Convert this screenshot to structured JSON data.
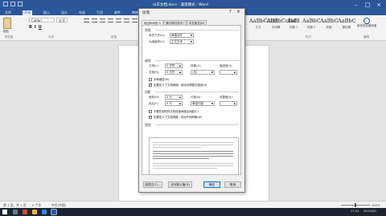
{
  "window": {
    "title": "山羊文档.docx - 兼容模式 - Word"
  },
  "ribbon_tabs": [
    "文件",
    "开始",
    "插入",
    "设计",
    "布局",
    "引用",
    "邮件",
    "审阅",
    "视图",
    "百度网盘"
  ],
  "ribbon": {
    "paste_label": "粘贴",
    "font_name": "Calibri",
    "font_size": "五号",
    "format_buttons": [
      "B",
      "I",
      "U"
    ],
    "groups": [
      "剪贴板",
      "字体",
      "段落",
      "样式",
      "编辑"
    ],
    "styles": [
      {
        "preview": "AaBbCcDd",
        "name": "正文"
      },
      {
        "preview": "AaBbCcDd",
        "name": "无间隔"
      },
      {
        "preview": "AaBl",
        "name": "标题 1"
      },
      {
        "preview": "AaBbC",
        "name": "标题 2"
      },
      {
        "preview": "AaBbC",
        "name": "标题"
      },
      {
        "preview": "AaBbC",
        "name": "副标题"
      }
    ],
    "right_tool_label": "保存到百度网盘"
  },
  "dialog": {
    "title": "段落",
    "help": "?",
    "close": "×",
    "tabs": [
      "缩进和间距(I)",
      "换行和分页(P)",
      "中文版式(H)"
    ],
    "general": {
      "heading": "常规",
      "alignment_label": "对齐方式(G):",
      "alignment_value": "两端对齐",
      "outline_label": "大纲级别(O):",
      "outline_value": "正文文本"
    },
    "indent": {
      "heading": "缩进",
      "left_label": "左侧(L):",
      "left_value": "0 字符",
      "right_label": "右侧(R):",
      "right_value": "0 字符",
      "special_label": "特殊(S):",
      "special_value": "(无)",
      "by_label": "缩进值(Y):",
      "mirror_label": "对称缩进(M)",
      "auto_adjust_label": "如果定义了文档网格，则自动调整右缩进(D)"
    },
    "spacing": {
      "heading": "间距",
      "before_label": "段前(B):",
      "before_value": "0 行",
      "after_label": "段后(F):",
      "after_value": "0 行",
      "line_label": "行距(N):",
      "line_value": "单倍行距",
      "at_label": "设置值(A):",
      "no_space_label": "不要在相同样式的段落间增加间距(C)",
      "snap_grid_label": "如果定义了文档网格，则对齐到网格(W)"
    },
    "preview_heading": "预览",
    "buttons": {
      "tabs": "制表位(T)...",
      "default": "设为默认值(D)",
      "ok": "确定",
      "cancel": "取消"
    },
    "checks": {
      "mirror": false,
      "auto_adjust": true,
      "no_space": false,
      "snap_grid": true
    }
  },
  "statusbar": {
    "page": "第 1 页，共 1 页",
    "words": "0 个字",
    "language": "中文(中国)",
    "zoom": "100%"
  },
  "taskbar": {
    "time": "17:24",
    "date": "2021/6/1"
  }
}
